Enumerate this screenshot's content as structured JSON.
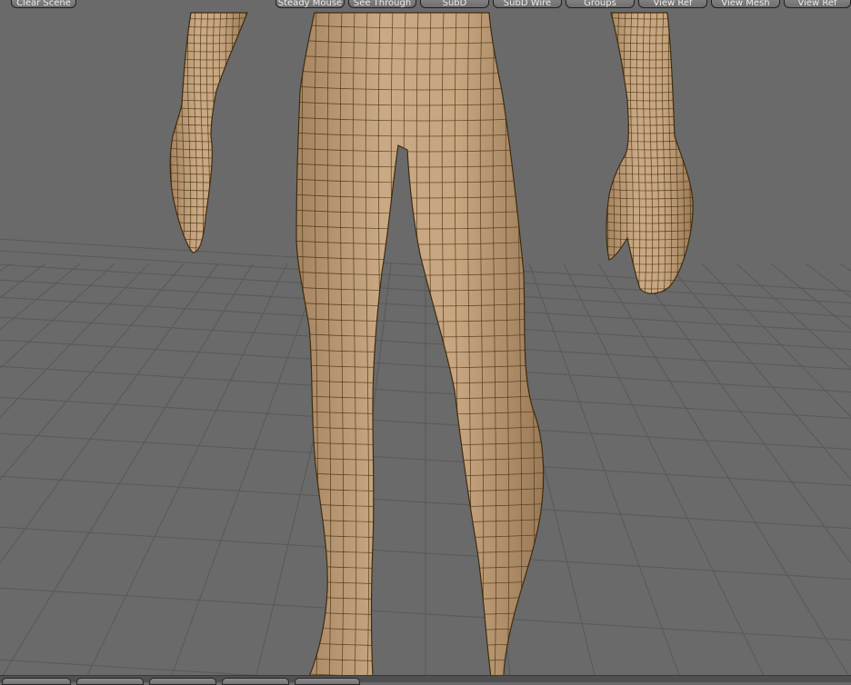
{
  "toolbar": {
    "buttons": [
      {
        "id": "clear-scene",
        "label": "Clear Scene"
      },
      {
        "id": "steady-mouse",
        "label": "Steady Mouse"
      },
      {
        "id": "see-through",
        "label": "See Through"
      },
      {
        "id": "subd",
        "label": "SubD"
      },
      {
        "id": "subd-wire",
        "label": "SubD Wire"
      },
      {
        "id": "groups",
        "label": "Groups"
      },
      {
        "id": "view-ref-left",
        "label": "View Ref"
      },
      {
        "id": "view-mesh",
        "label": "View Mesh"
      },
      {
        "id": "view-ref-right",
        "label": "View Ref"
      }
    ]
  },
  "viewport": {
    "background_color": "#6a6a6a",
    "grid_color": "#5a5a5a",
    "model_color": "#bf9f7b",
    "wire_color": "#4a3510"
  }
}
